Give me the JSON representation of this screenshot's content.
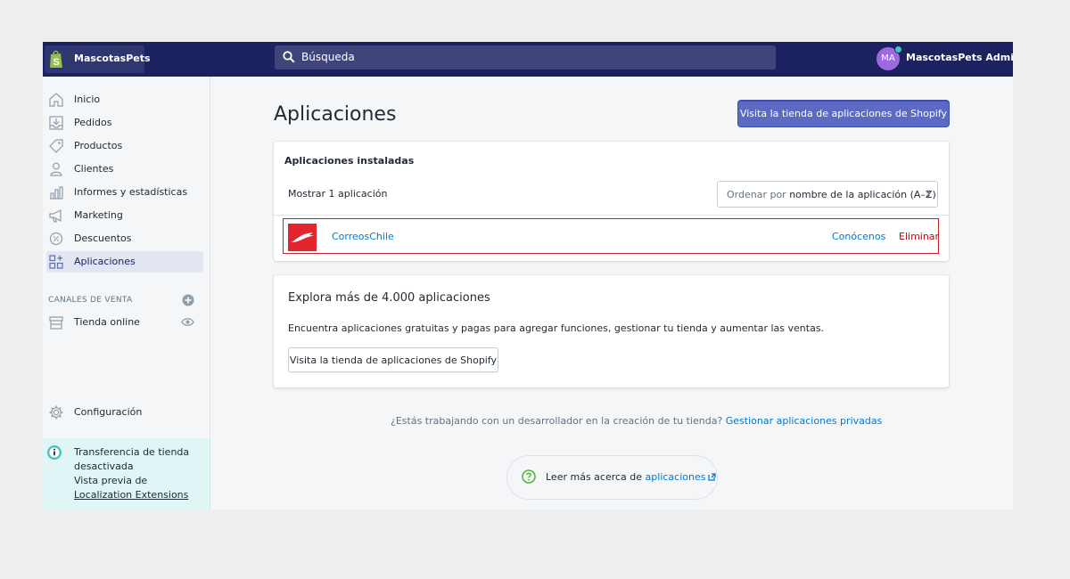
{
  "topbar": {
    "store_name": "MascotasPets",
    "search_placeholder": "Búsqueda",
    "avatar_initials": "MA",
    "admin_name": "MascotasPets Admin"
  },
  "sidebar": {
    "items": [
      {
        "label": "Inicio",
        "icon": "home-icon"
      },
      {
        "label": "Pedidos",
        "icon": "orders-icon"
      },
      {
        "label": "Productos",
        "icon": "tag-icon"
      },
      {
        "label": "Clientes",
        "icon": "person-icon"
      },
      {
        "label": "Informes y estadísticas",
        "icon": "bar-chart-icon"
      },
      {
        "label": "Marketing",
        "icon": "megaphone-icon"
      },
      {
        "label": "Descuentos",
        "icon": "discount-icon"
      },
      {
        "label": "Aplicaciones",
        "icon": "apps-icon",
        "active": true
      }
    ],
    "sales_channels_title": "CANALES DE VENTA",
    "online_store_label": "Tienda online",
    "settings_label": "Configuración",
    "transfer": {
      "line1": "Transferencia de tienda desactivada",
      "line2_prefix": "Vista previa de ",
      "line2_link": "Localization Extensions"
    }
  },
  "main": {
    "title": "Aplicaciones",
    "visit_store_button": "Visita la tienda de aplicaciones de Shopify",
    "installed": {
      "heading": "Aplicaciones instaladas",
      "count_text": "Mostrar 1 aplicación",
      "sort_prefix": "Ordenar por ",
      "sort_value": "nombre de la aplicación (A–Z)",
      "apps": [
        {
          "name": "CorreosChile",
          "link_label": "Conócenos",
          "delete_label": "Eliminar"
        }
      ]
    },
    "explore": {
      "title": "Explora más de 4.000 aplicaciones",
      "description": "Encuentra aplicaciones gratuitas y pagas para agregar funciones, gestionar tu tienda y aumentar las ventas.",
      "button_label": "Visita la tienda de aplicaciones de Shopify"
    },
    "private_apps": {
      "question": "¿Estás trabajando con un desarrollador en la creación de tu tienda? ",
      "link": "Gestionar aplicaciones privadas"
    },
    "learn_more": {
      "prefix": "Leer más acerca de ",
      "link": "aplicaciones"
    }
  },
  "colors": {
    "topbar": "#1c2260",
    "primary": "#5c6ac4",
    "link": "#007ace",
    "danger": "#bf0711",
    "app_logo": "#e3262d",
    "highlight_border": "#c1272d"
  }
}
